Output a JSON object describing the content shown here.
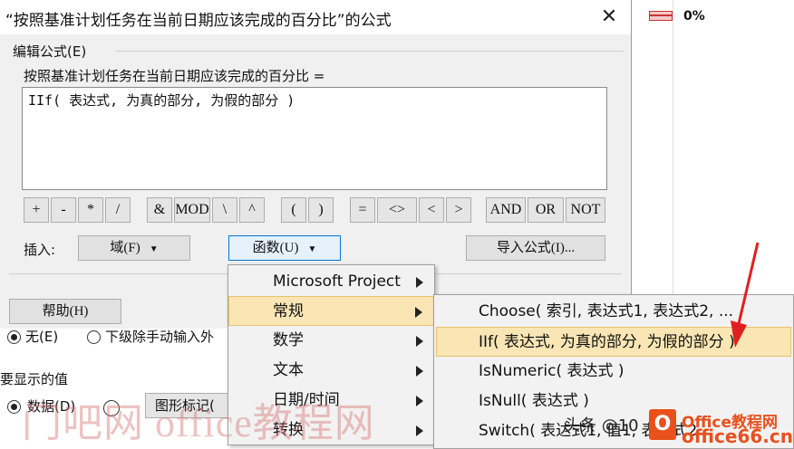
{
  "dialog": {
    "title": "“按照基准计划任务在当前日期应该完成的百分比”的公式",
    "edit_group_label": "编辑公式(E)",
    "field_label": "按照基准计划任务在当前日期应该完成的百分比 =",
    "formula_text": "IIf( 表达式, 为真的部分, 为假的部分 )",
    "operators": [
      "+",
      "-",
      "*",
      "/",
      "&",
      "MOD",
      "\\",
      "^",
      "(",
      ")",
      "=",
      "<>",
      "<",
      ">",
      "AND",
      "OR",
      "NOT"
    ],
    "insert_label": "插入:",
    "field_button": "域(F)",
    "function_button": "函数(U)",
    "import_button": "导入公式(I)...",
    "help_button": "帮助(H)"
  },
  "background": {
    "percent": "0%",
    "radio_none": "无(E)",
    "radio_roll": "下级除手动输入外",
    "values_label": "要显示的值",
    "radio_data": "数据(D)",
    "graphic_button": "图形标记("
  },
  "function_menu": {
    "items": [
      "Microsoft Project",
      "常规",
      "数学",
      "文本",
      "日期/时间",
      "转换"
    ],
    "highlighted": "常规"
  },
  "general_submenu": {
    "items": [
      "Choose( 索引, 表达式1, 表达式2, ...",
      "IIf( 表达式, 为真的部分, 为假的部分 )",
      "IsNumeric( 表达式 )",
      "IsNull( 表达式 )",
      "Switch( 表达式1, 值1, 表达式2"
    ],
    "highlighted": "IIf( 表达式, 为真的部分, 为假的部分 )"
  },
  "overlay": {
    "watermark": "门吧网 office教程网",
    "author": "头条 @10",
    "logo_letter": "O",
    "logo_top": "Office教程网",
    "logo_bottom": "office66.cn"
  },
  "colors": {
    "menu_highlight": "#fae6b4",
    "accent_blue": "#0078d7",
    "arrow_red": "#e02020",
    "logo_orange": "#e8501c"
  },
  "icons": [
    "close-icon",
    "dropdown-caret-icon",
    "submenu-arrow-icon",
    "annotation-arrow-icon"
  ]
}
